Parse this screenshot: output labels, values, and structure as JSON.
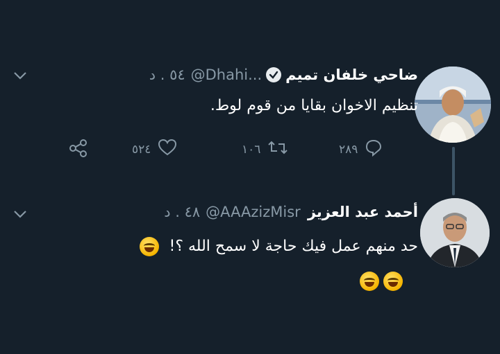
{
  "tweet1": {
    "name": "ضاحي خلفان تميم",
    "handle": "@Dhahi...",
    "meta": "٥٤ . د",
    "text": "تنظيم الاخوان بقايا من قوم لوط.",
    "actions": {
      "replies": "٢٨٩",
      "retweets": "١٠٦",
      "likes": "٥٢٤"
    }
  },
  "tweet2": {
    "name": "أحمد عبد العزيز",
    "handle": "@AAAzizMisr",
    "meta": "٤٨ . د",
    "text": "حد منهم عمل فيك حاجة لا سمح الله ؟!"
  },
  "icons": {
    "verified": "verified-badge-icon",
    "reply": "reply-icon",
    "retweet": "retweet-icon",
    "like": "heart-icon",
    "share": "share-icon",
    "more": "chevron-down-icon"
  },
  "colors": {
    "background": "#15202b",
    "secondary_text": "#8899a6",
    "thread_line": "#3d5466"
  }
}
